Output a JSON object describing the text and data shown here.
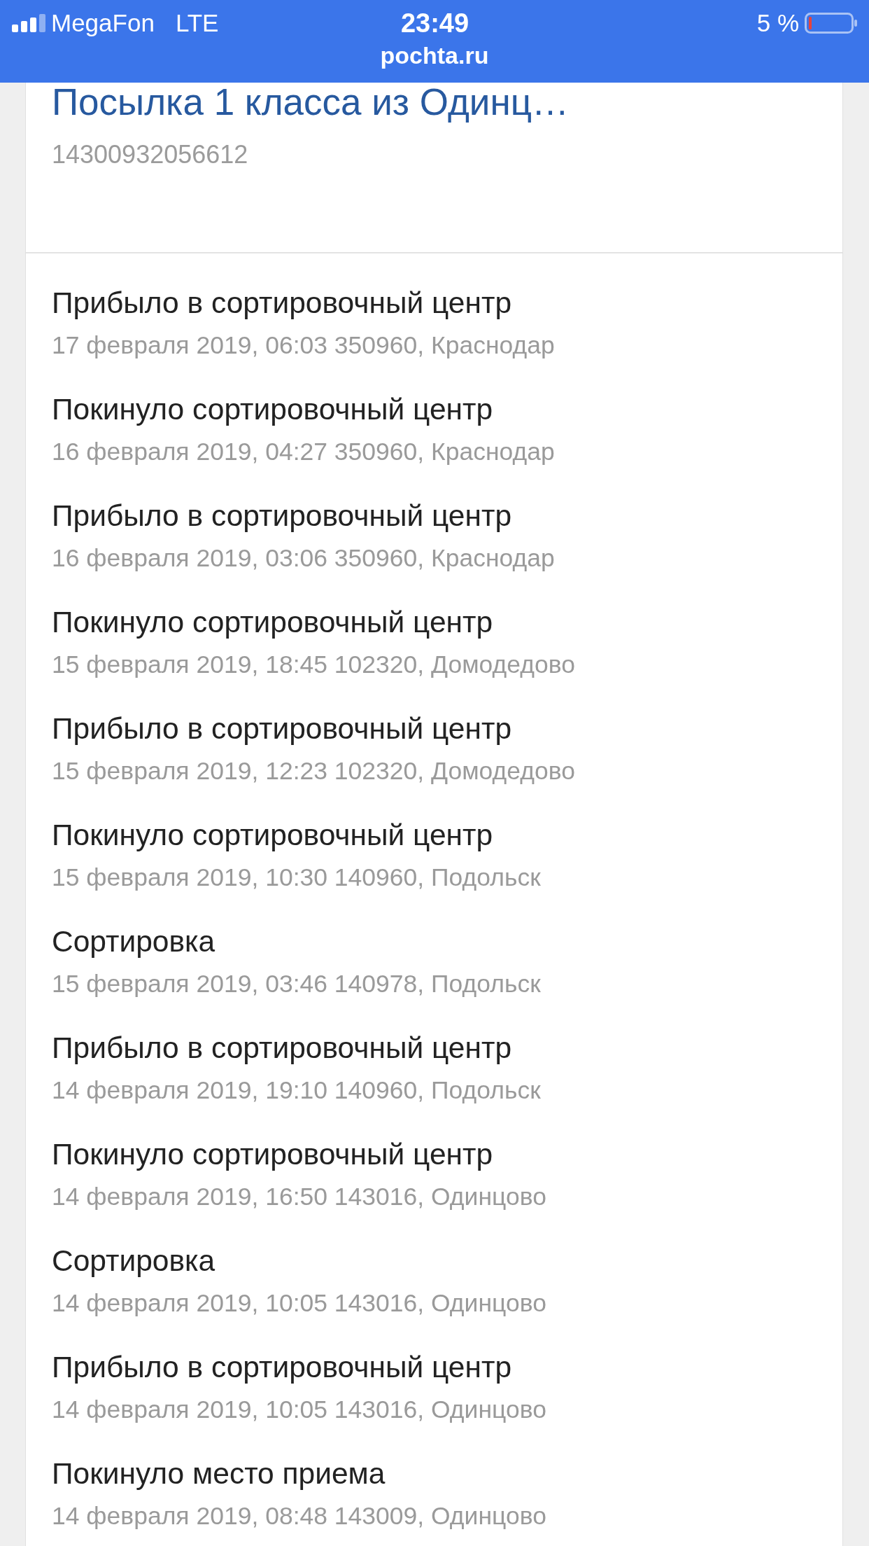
{
  "status_bar": {
    "carrier": "MegaFon",
    "network": "LTE",
    "time": "23:49",
    "battery": "5 %",
    "url": "pochta.ru"
  },
  "parcel": {
    "title": "Посылка 1 класса из Одинц…",
    "tracking_number": "14300932056612"
  },
  "events": [
    {
      "status": "Прибыло в сортировочный центр",
      "details": "17 февраля 2019, 06:03 350960, Краснодар"
    },
    {
      "status": "Покинуло сортировочный центр",
      "details": "16 февраля 2019, 04:27 350960, Краснодар"
    },
    {
      "status": "Прибыло в сортировочный центр",
      "details": "16 февраля 2019, 03:06 350960, Краснодар"
    },
    {
      "status": "Покинуло сортировочный центр",
      "details": "15 февраля 2019, 18:45 102320, Домодедово"
    },
    {
      "status": "Прибыло в сортировочный центр",
      "details": "15 февраля 2019, 12:23 102320, Домодедово"
    },
    {
      "status": "Покинуло сортировочный центр",
      "details": "15 февраля 2019, 10:30 140960, Подольск"
    },
    {
      "status": "Сортировка",
      "details": "15 февраля 2019, 03:46 140978, Подольск"
    },
    {
      "status": "Прибыло в сортировочный центр",
      "details": "14 февраля 2019, 19:10 140960, Подольск"
    },
    {
      "status": "Покинуло сортировочный центр",
      "details": "14 февраля 2019, 16:50 143016, Одинцово"
    },
    {
      "status": "Сортировка",
      "details": "14 февраля 2019, 10:05 143016, Одинцово"
    },
    {
      "status": "Прибыло в сортировочный центр",
      "details": "14 февраля 2019, 10:05 143016, Одинцово"
    },
    {
      "status": "Покинуло место приема",
      "details": "14 февраля 2019, 08:48 143009, Одинцово"
    }
  ]
}
